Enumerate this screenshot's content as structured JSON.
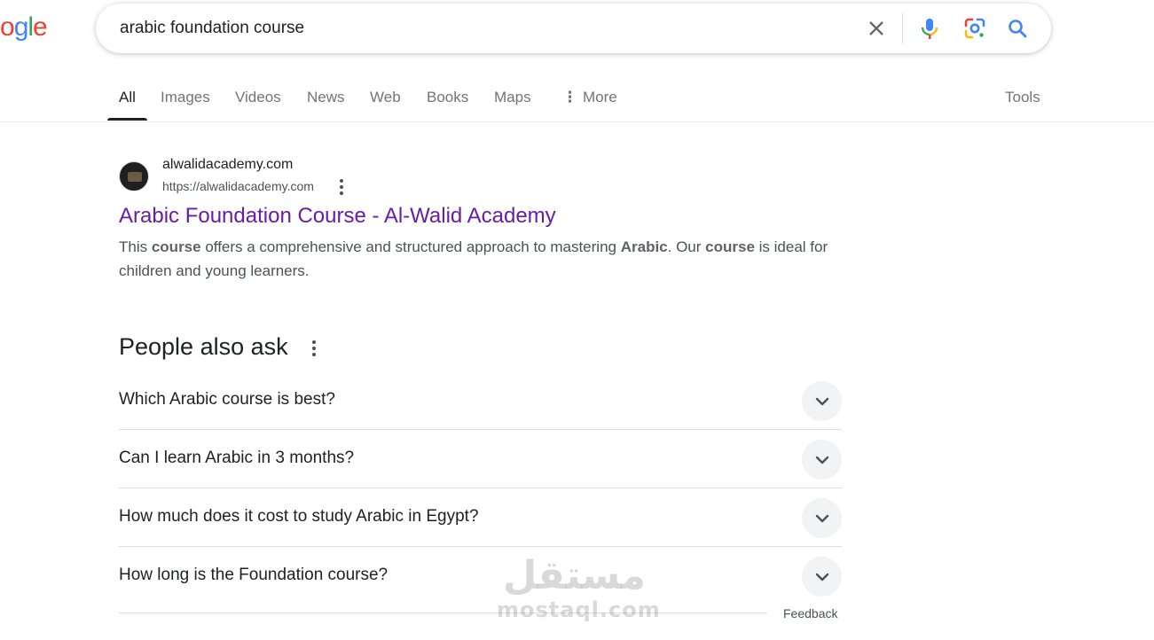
{
  "logo": {
    "visible_text": "gle",
    "colors": [
      "#4285f4",
      "#34a853",
      "#ea4335"
    ]
  },
  "search": {
    "query": "arabic foundation course",
    "clear_icon": "close-icon",
    "mic_icon": "microphone-icon",
    "lens_icon": "google-lens-icon",
    "search_icon": "search-icon"
  },
  "tabs": [
    {
      "label": "All",
      "active": true
    },
    {
      "label": "Images"
    },
    {
      "label": "Videos"
    },
    {
      "label": "News"
    },
    {
      "label": "Web"
    },
    {
      "label": "Books"
    },
    {
      "label": "Maps"
    },
    {
      "label": "More",
      "icon": "vertical-dots-icon"
    }
  ],
  "tools_label": "Tools",
  "result": {
    "site_name": "alwalidacademy.com",
    "url": "https://alwalidacademy.com",
    "title": "Arabic Foundation Course - Al-Walid Academy",
    "snippet": [
      {
        "text": "This ",
        "bold": false
      },
      {
        "text": "course",
        "bold": true
      },
      {
        "text": " offers a comprehensive and structured approach to mastering ",
        "bold": false
      },
      {
        "text": "Arabic",
        "bold": true
      },
      {
        "text": ". Our ",
        "bold": false
      },
      {
        "text": "course",
        "bold": true
      },
      {
        "text": " is ideal for children and young learners.",
        "bold": false
      }
    ],
    "title_color": "#681da8"
  },
  "people_also_ask": {
    "title": "People also ask",
    "questions": [
      "Which Arabic course is best?",
      "Can I learn Arabic in 3 months?",
      "How much does it cost to study Arabic in Egypt?",
      "How long is the Foundation course?"
    ]
  },
  "feedback_label": "Feedback",
  "watermark": {
    "arabic": "مستقل",
    "latin": "mostaql.com"
  }
}
